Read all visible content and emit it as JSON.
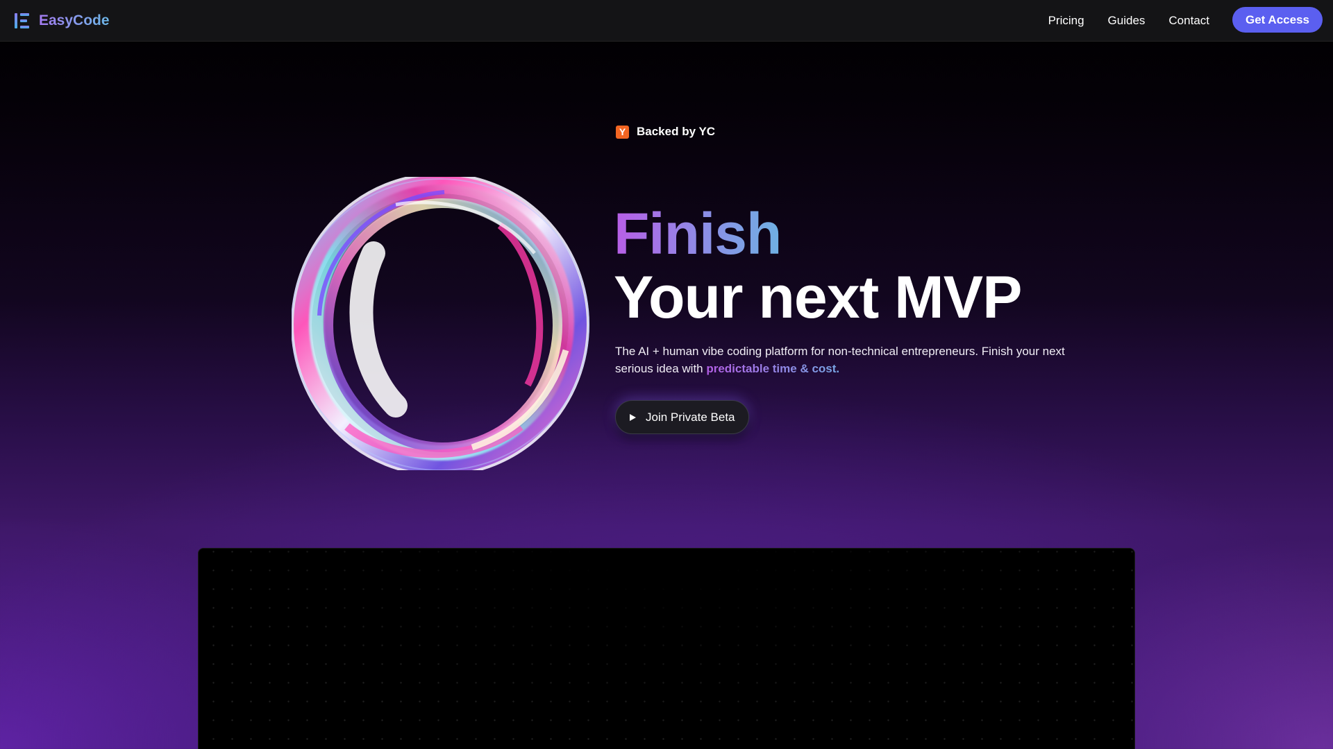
{
  "nav": {
    "brand": "EasyCode",
    "links": [
      "Pricing",
      "Guides",
      "Contact"
    ],
    "cta": "Get Access"
  },
  "hero": {
    "badge_icon_letter": "Y",
    "badge_text": "Backed by YC",
    "title_line1": "Finish",
    "title_line2": "Your next MVP",
    "description": "The AI + human vibe coding platform for non-technical entrepreneurs. Finish your next serious idea with ",
    "description_link": "predictable time & cost.",
    "cta": "Join Private Beta"
  },
  "colors": {
    "accent_button": "#5b5ff0",
    "gradient_purple": "#b85ee6",
    "gradient_blue": "#6fb1e3",
    "yc_orange": "#f26522",
    "background_bottom_glow": "#7a34c8"
  },
  "icons": {
    "logo": "easycode-logo-icon",
    "badge": "yc-icon",
    "cta": "play-icon",
    "hero_art": "iridescent-ring-illustration"
  }
}
